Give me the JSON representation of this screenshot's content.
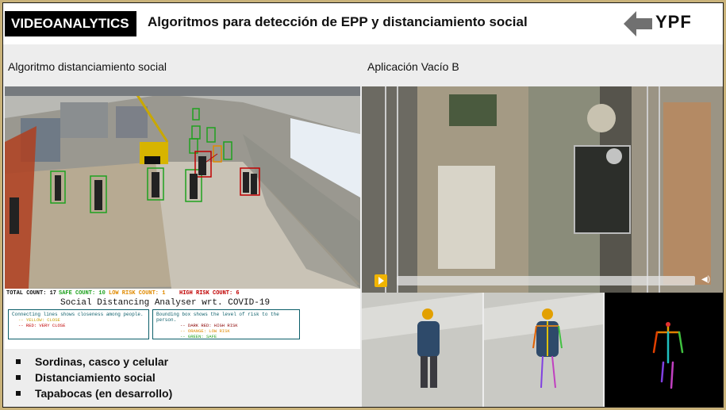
{
  "header": {
    "badge": "VIDEOANALYTICS",
    "title": "Algoritmos para detección de EPP y distanciamiento social",
    "logo_text": "YPF",
    "logo_icon": "arrow-left-icon"
  },
  "left_section": {
    "label": "Algoritmo distanciamiento social",
    "stats": {
      "total": "TOTAL COUNT: 17",
      "safe": "SAFE COUNT: 10",
      "low": "LOW RISK COUNT: 1",
      "high": "HIGH RISK COUNT: 6",
      "analyser_title": "Social Distancing Analyser wrt. COVID-19",
      "legend_left_title": "Connecting lines shows closeness among people.",
      "legend_left_rows": [
        "-- YELLOW: CLOSE",
        "-- RED: VERY CLOSE"
      ],
      "legend_right_title": "Bounding box shows the level of risk to the person.",
      "legend_right_rows": [
        "-- DARK RED: HIGH RISK",
        "-- ORANGE: LOW RISK",
        "-- GREEN: SAFE"
      ]
    }
  },
  "right_section": {
    "label": "Aplicación Vacío B",
    "player": {
      "play_icon": "play-icon",
      "volume_icon": "volume-icon"
    }
  },
  "bullets": [
    "Sordinas, casco y celular",
    "Distanciamiento social",
    "Tapabocas (en desarrollo)"
  ],
  "colors": {
    "safe": "#1fa11f",
    "low_risk": "#e08a00",
    "high_risk": "#c00000",
    "badge_bg": "#000000",
    "frame": "#c9b27a"
  }
}
